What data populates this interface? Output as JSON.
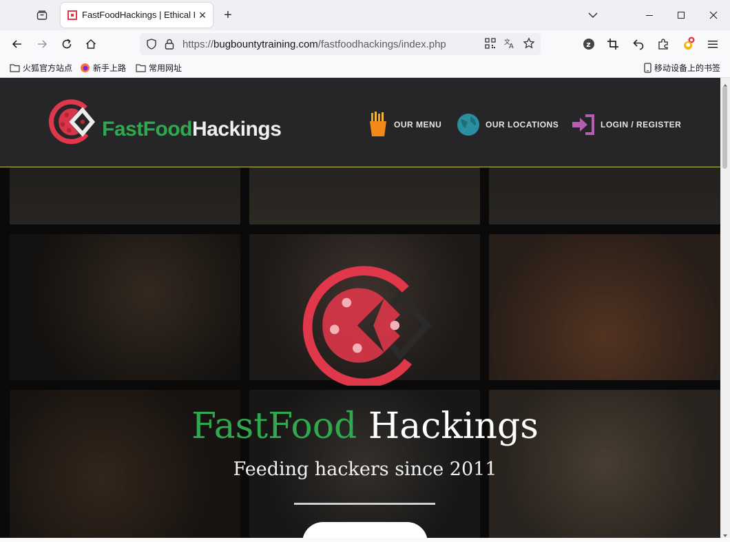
{
  "browser": {
    "tab_title": "FastFoodHackings | Ethical H",
    "url_prefix": "https://",
    "url_host": "bugbountytraining.com",
    "url_path": "/fastfoodhackings/index.php",
    "bookmarks": [
      "火狐官方站点",
      "新手上路",
      "常用网址"
    ],
    "mobile_bookmarks": "移动设备上的书签"
  },
  "site": {
    "logo_part1": "FastFood",
    "logo_part2": "Hackings",
    "menu": [
      {
        "label": "OUR MENU",
        "icon": "fries-icon"
      },
      {
        "label": "OUR LOCATIONS",
        "icon": "globe-icon"
      },
      {
        "label": "LOGIN / REGISTER",
        "icon": "login-icon"
      }
    ]
  },
  "hero": {
    "title_part1": "FastFood",
    "title_part2": "Hackings",
    "subtitle": "Feeding hackers since 2011"
  },
  "colors": {
    "brand_red": "#e0374a",
    "brand_green": "#2fa84f",
    "header_bg": "#262628",
    "accent_line": "#c6c94a"
  }
}
